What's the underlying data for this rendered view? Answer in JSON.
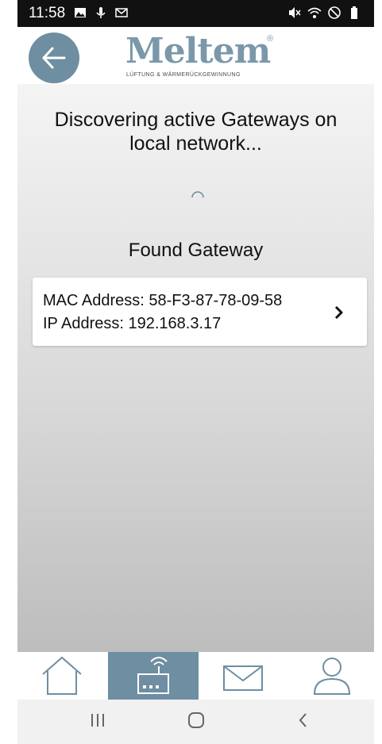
{
  "status_bar": {
    "time": "11:58",
    "left_icons": [
      "image-icon",
      "microphone-icon",
      "gmail-icon"
    ],
    "right_icons": [
      "muted-signal-icon",
      "wifi-icon",
      "do-not-disturb-icon",
      "battery-icon"
    ]
  },
  "header": {
    "back_icon": "arrow-left-icon",
    "logo_word": "Meltem",
    "logo_registered": "®",
    "logo_tagline": "LÜFTUNG & WÄRMERÜCKGEWINNUNG"
  },
  "main": {
    "discover_text": "Discovering active Gateways on local network...",
    "found_title": "Found Gateway",
    "gateway": {
      "mac_line": "MAC Address: 58-F3-87-78-09-58",
      "ip_line": "IP Address: 192.168.3.17"
    }
  },
  "tab_bar": {
    "tabs": [
      {
        "name": "home",
        "icon": "house-icon",
        "active": false
      },
      {
        "name": "gateway",
        "icon": "router-icon",
        "active": true
      },
      {
        "name": "messages",
        "icon": "envelope-icon",
        "active": false
      },
      {
        "name": "profile",
        "icon": "person-icon",
        "active": false
      }
    ]
  },
  "nav_bar": {
    "recent_glyph": "|||",
    "back_glyph": "<"
  },
  "colors": {
    "accent": "#6e8ea2",
    "logo": "#7b98aa",
    "status_bar": "#111111",
    "card": "#ffffff"
  }
}
